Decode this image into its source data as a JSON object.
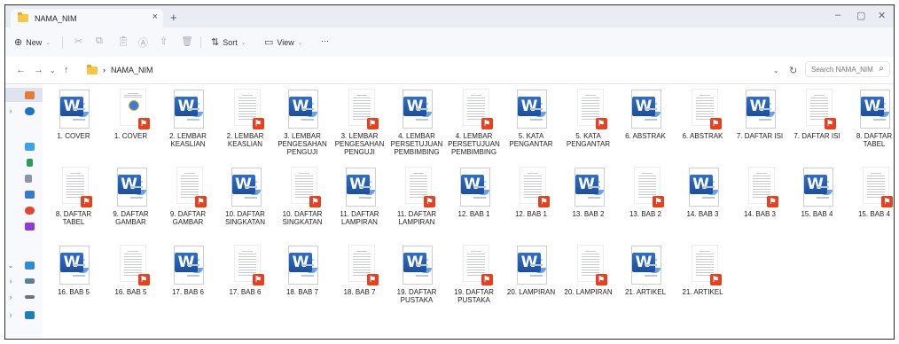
{
  "tab": {
    "title": "NAMA_NIM",
    "close": "×",
    "new_tab": "+"
  },
  "window_controls": {
    "minimize": "–",
    "maximize": "▢",
    "close": "✕"
  },
  "toolbar": {
    "new_label": "New",
    "sort_label": "Sort",
    "view_label": "View",
    "more_label": "···"
  },
  "address": {
    "crumb": "NAMA_NIM",
    "search_placeholder": "Search NAMA_NIM"
  },
  "files": [
    {
      "label": "1. COVER",
      "type": "word"
    },
    {
      "label": "1. COVER",
      "type": "pdf"
    },
    {
      "label": "2. LEMBAR KEASLIAN",
      "type": "word"
    },
    {
      "label": "2. LEMBAR KEASLIAN",
      "type": "pdf"
    },
    {
      "label": "3. LEMBAR PENGESAHAN PENGUJI",
      "type": "word"
    },
    {
      "label": "3. LEMBAR PENGESAHAN PENGUJI",
      "type": "pdf"
    },
    {
      "label": "4. LEMBAR PERSETUJUAN PEMBIMBING",
      "type": "word"
    },
    {
      "label": "4. LEMBAR PERSETUJUAN PEMBIMBING",
      "type": "pdf"
    },
    {
      "label": "5. KATA PENGANTAR",
      "type": "word"
    },
    {
      "label": "5. KATA PENGANTAR",
      "type": "pdf"
    },
    {
      "label": "6. ABSTRAK",
      "type": "word"
    },
    {
      "label": "6. ABSTRAK",
      "type": "pdf"
    },
    {
      "label": "7. DAFTAR ISI",
      "type": "word"
    },
    {
      "label": "7. DAFTAR ISI",
      "type": "pdf"
    },
    {
      "label": "8. DAFTAR TABEL",
      "type": "word"
    },
    {
      "label": "8. DAFTAR TABEL",
      "type": "pdf"
    },
    {
      "label": "9. DAFTAR GAMBAR",
      "type": "word"
    },
    {
      "label": "9. DAFTAR GAMBAR",
      "type": "pdf"
    },
    {
      "label": "10. DAFTAR SINGKATAN",
      "type": "word"
    },
    {
      "label": "10. DAFTAR SINGKATAN",
      "type": "pdf"
    },
    {
      "label": "11. DAFTAR LAMPIRAN",
      "type": "word"
    },
    {
      "label": "11. DAFTAR LAMPIRAN",
      "type": "pdf"
    },
    {
      "label": "12. BAB 1",
      "type": "word"
    },
    {
      "label": "12. BAB 1",
      "type": "pdf"
    },
    {
      "label": "13. BAB 2",
      "type": "word"
    },
    {
      "label": "13. BAB 2",
      "type": "pdf"
    },
    {
      "label": "14. BAB 3",
      "type": "word"
    },
    {
      "label": "14. BAB 3",
      "type": "pdf"
    },
    {
      "label": "15. BAB 4",
      "type": "word"
    },
    {
      "label": "15. BAB 4",
      "type": "pdf"
    },
    {
      "label": "16. BAB 5",
      "type": "word"
    },
    {
      "label": "16. BAB 5",
      "type": "pdf"
    },
    {
      "label": "17. BAB 6",
      "type": "word"
    },
    {
      "label": "17. BAB 6",
      "type": "pdf"
    },
    {
      "label": "18. BAB 7",
      "type": "word"
    },
    {
      "label": "18. BAB 7",
      "type": "pdf"
    },
    {
      "label": "19. DAFTAR PUSTAKA",
      "type": "word"
    },
    {
      "label": "19. DAFTAR PUSTAKA",
      "type": "pdf"
    },
    {
      "label": "20. LAMPIRAN",
      "type": "word"
    },
    {
      "label": "20. LAMPIRAN",
      "type": "pdf"
    },
    {
      "label": "21. ARTIKEL",
      "type": "word"
    },
    {
      "label": "21. ARTIKEL",
      "type": "pdf"
    }
  ]
}
